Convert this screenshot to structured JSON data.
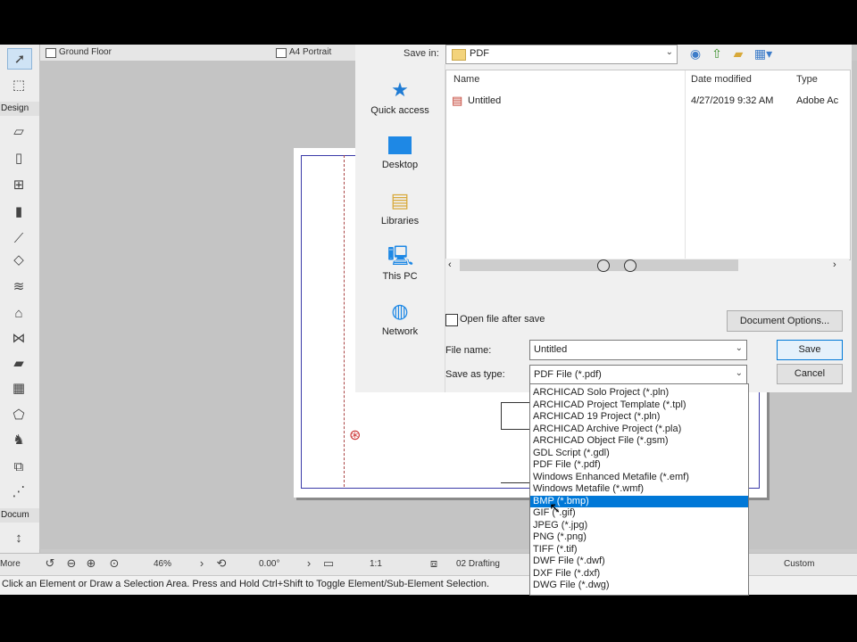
{
  "window": {
    "tabs": [
      {
        "label": "Ground Floor"
      },
      {
        "label": "A4 Portrait"
      }
    ]
  },
  "toolbox": {
    "sections": [
      "Design",
      "Docum",
      "More"
    ]
  },
  "status": {
    "zoom": "46%",
    "angle": "0.00°",
    "scale": "1:1",
    "layer_combo": "02 Drafting",
    "custom": "Custom"
  },
  "info_text": "Click an Element or Draw a Selection Area. Press and Hold Ctrl+Shift to Toggle Element/Sub-Element Selection.",
  "dialog": {
    "save_in_label": "Save in:",
    "save_in_value": "PDF",
    "nav": [
      {
        "label": "Quick access",
        "icon": "star-icon"
      },
      {
        "label": "Desktop",
        "icon": "desktop-icon"
      },
      {
        "label": "Libraries",
        "icon": "libraries-icon"
      },
      {
        "label": "This PC",
        "icon": "computer-icon"
      },
      {
        "label": "Network",
        "icon": "network-icon"
      }
    ],
    "columns": {
      "name": "Name",
      "date": "Date modified",
      "type": "Type"
    },
    "files": [
      {
        "name": "Untitled",
        "date": "4/27/2019 9:32 AM",
        "type": "Adobe Ac"
      }
    ],
    "open_after_save": "Open file after save",
    "document_options": "Document Options...",
    "file_name_label": "File name:",
    "file_name_value": "Untitled",
    "save_as_type_label": "Save as type:",
    "save_as_type_value": "PDF File (*.pdf)",
    "save_button": "Save",
    "cancel_button": "Cancel",
    "type_options": [
      "ARCHICAD Solo Project (*.pln)",
      "ARCHICAD Project Template (*.tpl)",
      "ARCHICAD 19 Project (*.pln)",
      "ARCHICAD Archive Project (*.pla)",
      "ARCHICAD Object File (*.gsm)",
      "GDL Script (*.gdl)",
      "PDF File (*.pdf)",
      "Windows Enhanced Metafile (*.emf)",
      "Windows Metafile (*.wmf)",
      "BMP (*.bmp)",
      "GIF (*.gif)",
      "JPEG (*.jpg)",
      "PNG (*.png)",
      "TIFF (*.tif)",
      "DWF File (*.dwf)",
      "DXF File (*.dxf)",
      "DWG File (*.dwg)"
    ],
    "highlighted_index": 9
  },
  "colors": {
    "accent": "#0078d7",
    "sheet_border": "#3a3aa8"
  }
}
